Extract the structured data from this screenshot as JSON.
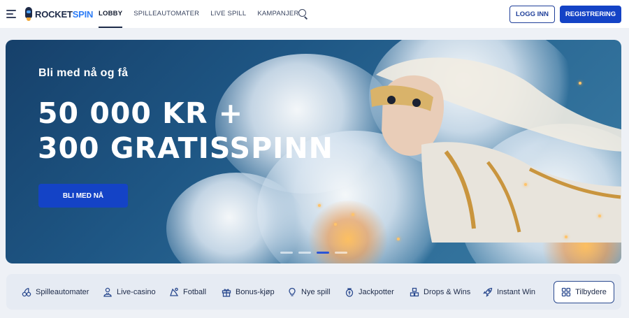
{
  "header": {
    "logo": {
      "part1": "ROCKET",
      "part2": "SPIN"
    },
    "nav": [
      {
        "label": "LOBBY",
        "active": true
      },
      {
        "label": "SPILLEAUTOMATER",
        "active": false
      },
      {
        "label": "LIVE SPILL",
        "active": false
      },
      {
        "label": "KAMPANJER",
        "active": false
      }
    ],
    "login_label": "LOGG INN",
    "register_label": "REGISTRERING"
  },
  "hero": {
    "subtitle": "Bli med nå og få",
    "title_line1": "50 000 KR +",
    "title_line2": "300 GRATISSPINN",
    "cta_label": "BLI MED NÅ",
    "slides": 4,
    "active_slide": 3
  },
  "categories": [
    {
      "label": "Spilleautomater",
      "icon": "cherries-icon"
    },
    {
      "label": "Live-casino",
      "icon": "dealer-icon"
    },
    {
      "label": "Fotball",
      "icon": "football-icon"
    },
    {
      "label": "Bonus-kjøp",
      "icon": "gift-icon"
    },
    {
      "label": "Nye spill",
      "icon": "lightbulb-icon"
    },
    {
      "label": "Jackpotter",
      "icon": "coin-icon"
    },
    {
      "label": "Drops & Wins",
      "icon": "blocks-icon"
    },
    {
      "label": "Instant Win",
      "icon": "rocket-icon"
    }
  ],
  "providers_label": "Tilbydere",
  "colors": {
    "primary": "#1443c6",
    "brand_dark": "#1d2a48",
    "brand_accent": "#2e7df6"
  }
}
